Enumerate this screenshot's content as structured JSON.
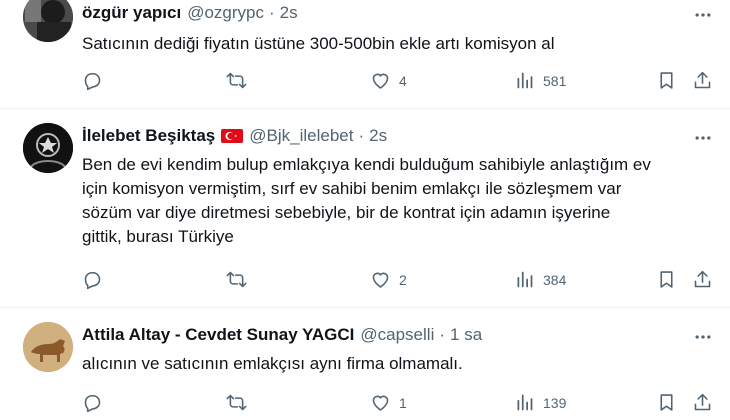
{
  "tweets": [
    {
      "name": "özgür yapıcı",
      "handle": "@ozgrypc",
      "dot": "·",
      "time": "2s",
      "text": "Satıcının dediği fiyatın üstüne 300-500bin ekle artı komisyon al",
      "likes": "4",
      "views": "581"
    },
    {
      "name": "İlelebet Beşiktaş",
      "handle": "@Bjk_ilelebet",
      "dot": "·",
      "time": "2s",
      "text_lines": [
        "Ben de evi kendim bulup emlakçıya kendi bulduğum sahibiyle anlaştığım ev",
        "için komisyon vermiştim, sırf ev sahibi benim emlakçı ile sözleşmem var",
        "sözüm var diye diretmesi sebebiyle, bir de kontrat için adamın işyerine",
        "gittik, burası Türkiye"
      ],
      "likes": "2",
      "views": "384"
    },
    {
      "name": "Attila Altay - Cevdet Sunay YAGCI",
      "handle": "@capselli",
      "dot": "·",
      "time": "1 sa",
      "text": "alıcının ve satıcının emlakçısı aynı firma olmamalı.",
      "likes": "1",
      "views": "139"
    }
  ],
  "icons": {
    "reply": "reply-icon",
    "retweet": "retweet-icon",
    "like": "heart-icon",
    "views": "views-icon",
    "bookmark": "bookmark-icon",
    "share": "share-icon",
    "more": "more-icon"
  },
  "colors": {
    "text": "#0f1419",
    "muted": "#536471",
    "divider": "#eff3f4",
    "flag_red": "#e30a17"
  }
}
